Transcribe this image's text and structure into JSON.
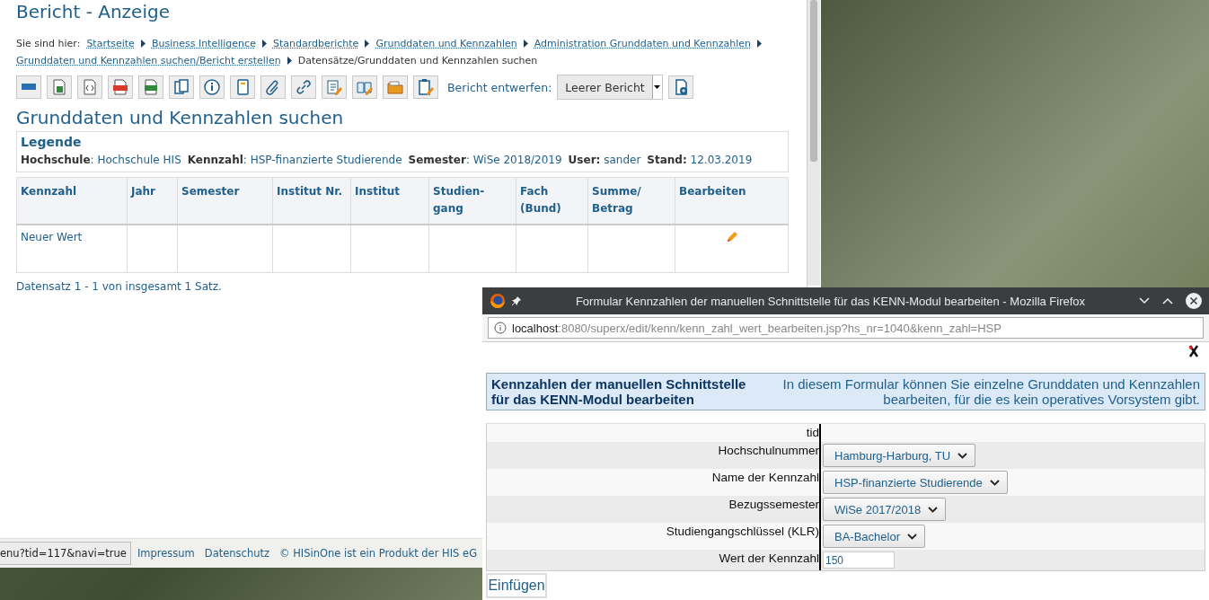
{
  "main_window": {
    "title": "Bericht - Anzeige",
    "breadcrumb": {
      "label": "Sie sind hier:",
      "items": [
        {
          "text": "Startseite",
          "link": true
        },
        {
          "text": "Business Intelligence",
          "link": true
        },
        {
          "text": "Standardberichte",
          "link": true
        },
        {
          "text": "Grunddaten und Kennzahlen",
          "link": true
        },
        {
          "text": "Administration Grunddaten und Kennzahlen",
          "link": true
        },
        {
          "text": "Grunddaten und Kennzahlen suchen/Bericht erstellen",
          "link": true
        },
        {
          "text": "Datensätze/Grunddaten und Kennzahlen suchen",
          "link": false
        }
      ]
    },
    "toolbar": {
      "buttons": [
        {
          "kind": "html"
        },
        {
          "kind": "excel"
        },
        {
          "kind": "xml"
        },
        {
          "kind": "pdf"
        },
        {
          "kind": "csv"
        },
        {
          "kind": "copy"
        },
        {
          "kind": "info"
        },
        {
          "kind": "notebook"
        },
        {
          "kind": "clip"
        },
        {
          "kind": "link"
        },
        {
          "kind": "edit"
        },
        {
          "kind": "book"
        },
        {
          "kind": "folder"
        },
        {
          "kind": "paste"
        }
      ],
      "design_label": "Bericht entwerfen:",
      "design_select": "Leerer Bericht",
      "add_button": true
    },
    "section_title": "Grunddaten und Kennzahlen suchen",
    "legend": {
      "title": "Legende",
      "items": [
        "**Hochschule**: Hochschule HIS",
        "**Kennzahl**: HSP-finanzierte Studierende",
        "**Semester**: WiSe 2018/2019",
        "**User:** sander",
        "**Stand:** 12.03.2019"
      ]
    },
    "table": {
      "columns": [
        "Kennzahl",
        "Jahr",
        "Semester",
        "Institut Nr.",
        "Institut",
        "Studien-gang",
        "Fach (Bund)",
        "Summe/ Betrag",
        "Bearbeiten"
      ],
      "rows": [
        {
          "cells": [
            "Neuer Wert",
            "",
            "",
            "",
            "",
            "",
            "",
            ""
          ],
          "editable": true
        }
      ]
    },
    "record_count": "Datensatz 1 - 1 von insgesamt 1 Satz.",
    "status_url": "enu?tid=117&navi=true",
    "footer_links": [
      "Impressum",
      "Datenschutz",
      "© HISinOne ist ein Produkt der HIS eG"
    ]
  },
  "popup_window": {
    "title": "Formular Kennzahlen der manuellen Schnittstelle für das KENN-Modul bearbeiten - Mozilla Firefox",
    "url": {
      "host": "localhost",
      "path": ":8080/superx/edit/kenn/kenn_zahl_wert_bearbeiten.jsp?hs_nr=1040&kenn_zahl=HSP"
    },
    "header": {
      "title": "Kennzahlen der manuellen Schnittstelle für das KENN-Modul bearbeiten",
      "description": "In diesem Formular können Sie einzelne Grunddaten und Kennzahlen bearbeiten, für die es kein operatives Vorsystem gibt."
    },
    "fields": [
      {
        "label": "tid",
        "kind": "empty"
      },
      {
        "label": "Hochschulnummer",
        "kind": "select",
        "value": "Hamburg-Harburg, TU"
      },
      {
        "label": "Name der Kennzahl",
        "kind": "select",
        "value": "HSP-finanzierte Studierende"
      },
      {
        "label": "Bezugssemester",
        "kind": "select",
        "value": "WiSe 2017/2018"
      },
      {
        "label": "Studiengangschlüssel (KLR)",
        "kind": "select",
        "value": "BA-Bachelor"
      },
      {
        "label": "Wert der Kennzahl",
        "kind": "input",
        "value": "150"
      }
    ],
    "submit": "Einfügen"
  }
}
